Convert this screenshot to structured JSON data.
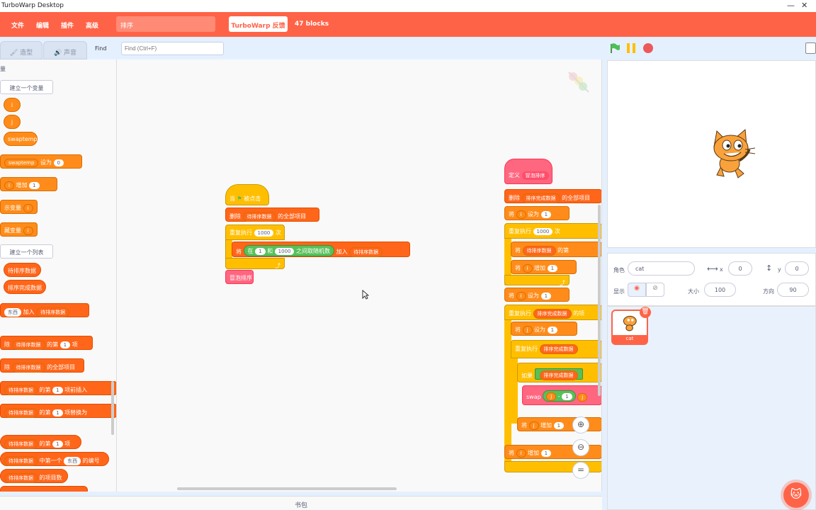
{
  "window": {
    "title": "TurboWarp Desktop",
    "minimize": "—",
    "close": "✕"
  },
  "menu": {
    "file": "文件",
    "edit": "编辑",
    "addons": "插件",
    "advanced": "高级",
    "project_name": "排序",
    "feedback": "TurboWarp 反馈",
    "block_count": "47 blocks"
  },
  "tabs": {
    "costumes": "造型",
    "sounds": "声音"
  },
  "find": {
    "label": "Find",
    "placeholder": "Find (Ctrl+F)"
  },
  "palette": {
    "section": "量",
    "make_variable": "建立一个变量",
    "var_i": "i",
    "var_j": "j",
    "var_swaptemp": "swaptemp",
    "set_var": "swaptemp",
    "set_to": "设为",
    "set_val": "0",
    "change_var": "i",
    "change_by": "增加",
    "change_val": "1",
    "show_var": "示变量",
    "show_var_name": "i",
    "hide_var": "藏变量",
    "hide_var_name": "i",
    "make_list": "建立一个列表",
    "list1": "待排序数据",
    "list2": "排序完成数据",
    "add_item": "东西",
    "add_to": "加入",
    "add_list": "待排序数据",
    "delete_of": "除",
    "delete_list": "待排序数据",
    "delete_nth": "的第",
    "delete_n": "1",
    "delete_item": "项",
    "delete_all": "除",
    "delete_all_list": "待排序数据",
    "delete_all_label": "的全部项目",
    "insert_list": "待排序数据",
    "insert_nth": "的第",
    "insert_n": "1",
    "insert_label": "项前插入",
    "replace_list": "待排序数据",
    "replace_nth": "的第",
    "replace_n": "1",
    "replace_label": "项替换为",
    "item_list": "待排序数据",
    "item_nth": "的第",
    "item_n": "1",
    "item_label": "项",
    "index_list": "待排序数据",
    "index_label": "中第一个",
    "index_thing": "东西",
    "index_suffix": "的编号",
    "length_list": "待排序数据",
    "length_label": "的项目数"
  },
  "script1": {
    "hat": "当",
    "hat_suffix": "被点击",
    "delete_all": "删除",
    "delete_all_list": "待排序数据",
    "delete_all_label": "的全部项目",
    "repeat": "重复执行",
    "repeat_n": "1000",
    "repeat_suffix": "次",
    "add": "将",
    "random_in": "在",
    "random_a": "1",
    "random_and": "和",
    "random_b": "1000",
    "random_label": "之间取随机数",
    "add_to": "加入",
    "add_list": "待排序数据",
    "call": "冒泡排序"
  },
  "script2": {
    "define": "定义",
    "define_name": "冒泡排序",
    "delete": "删除",
    "delete_list": "排序完成数据",
    "delete_label": "的全部项目",
    "set": "将",
    "set_var": "i",
    "set_to": "设为",
    "set_val": "1",
    "repeat": "重复执行",
    "repeat_n": "1000",
    "repeat_suffix": "次",
    "inner_set": "将",
    "inner_list": "待排序数据",
    "inner_label": "的第",
    "change": "将",
    "change_var": "i",
    "change_by": "增加",
    "change_val": "1",
    "set2": "将",
    "set2_var": "i",
    "set2_to": "设为",
    "set2_val": "1",
    "repeat2": "重复执行",
    "repeat2_list": "排序完成数据",
    "repeat2_label": "的项",
    "set3": "将",
    "set3_var": "j",
    "set3_to": "设为",
    "set3_val": "1",
    "repeat3": "重复执行",
    "repeat3_list": "排序完成数据",
    "if": "如果",
    "if_list": "排序完成数据",
    "swap": "swap",
    "swap_a": "j",
    "swap_minus": "-",
    "swap_b": "1",
    "swap_c": "j",
    "change_j": "将",
    "change_j_var": "j",
    "change_j_by": "增加",
    "change_j_val": "1",
    "change_i": "将",
    "change_i_var": "i",
    "change_i_by": "增加",
    "change_i_val": "1"
  },
  "backpack": "书包",
  "sprite": {
    "sprite_label": "角色",
    "name": "cat",
    "x_label": "x",
    "x": "0",
    "y_label": "y",
    "y": "0",
    "show_label": "显示",
    "size_label": "大小",
    "size": "100",
    "direction_label": "方向",
    "direction": "90",
    "thumb_name": "cat"
  },
  "colors": {
    "accent": "#ff6347",
    "variables": "#ff8c1a",
    "lists": "#ff661a",
    "events": "#ffbf00",
    "operators": "#59c059",
    "custom": "#ff6680"
  }
}
